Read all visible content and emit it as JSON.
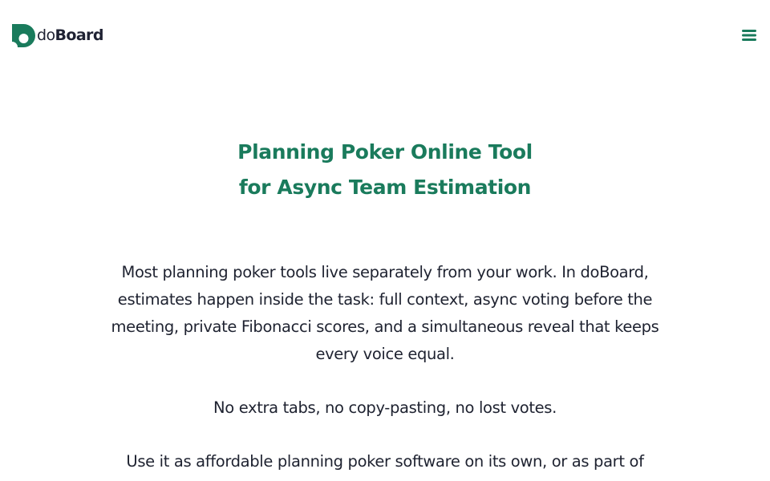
{
  "brand": {
    "name_prefix": "do",
    "name_suffix": "Board",
    "accent_color": "#1a7b5c",
    "text_color": "#1f2233"
  },
  "header": {
    "menu_icon": "hamburger-menu-icon"
  },
  "hero": {
    "title_line1": "Planning Poker Online Tool",
    "title_line2": "for Async Team Estimation",
    "paragraph1": "Most planning poker tools live separately from your work. In doBoard, estimates happen inside the task: full context, async voting before the meeting, private Fibonacci scores, and a simultaneous reveal that keeps every voice equal.",
    "paragraph2": "No extra tabs, no copy-pasting, no lost votes.",
    "paragraph3": "Use it as affordable planning poker software on its own, or as part of"
  }
}
